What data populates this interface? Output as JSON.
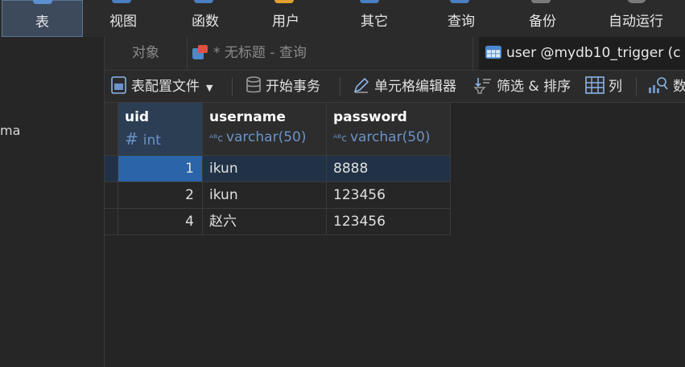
{
  "toolbar_top": {
    "items": [
      {
        "label": "表",
        "icon": "table-icon",
        "active": true
      },
      {
        "label": "视图",
        "icon": "view-icon"
      },
      {
        "label": "函数",
        "icon": "function-icon"
      },
      {
        "label": "用户",
        "icon": "user-icon"
      },
      {
        "label": "其它",
        "icon": "other-icon"
      },
      {
        "label": "查询",
        "icon": "query-icon"
      },
      {
        "label": "备份",
        "icon": "backup-icon"
      },
      {
        "label": "自动运行",
        "icon": "automation-icon"
      }
    ]
  },
  "sidebar": {
    "partial_text": "ma"
  },
  "tabs": [
    {
      "label": "对象"
    },
    {
      "label": "* 无标题 - 查询",
      "icon": "query-tab-icon"
    },
    {
      "label": "user @mydb10_trigger (c",
      "icon": "table-tab-icon",
      "active": true
    }
  ],
  "toolbar": {
    "profile_label": "表配置文件",
    "transaction_label": "开始事务",
    "cell_editor_label": "单元格编辑器",
    "filter_sort_label": "筛选 & 排序",
    "columns_label": "列",
    "data_label": "数"
  },
  "columns": [
    {
      "name": "uid",
      "type": "int"
    },
    {
      "name": "username",
      "type": "varchar(50)"
    },
    {
      "name": "password",
      "type": "varchar(50)"
    }
  ],
  "rows": [
    {
      "uid": "1",
      "username": "ikun",
      "password": "8888",
      "selected": true
    },
    {
      "uid": "2",
      "username": "ikun",
      "password": "123456"
    },
    {
      "uid": "4",
      "username": "赵六",
      "password": "123456"
    }
  ],
  "colors": {
    "accent": "#2b64a8",
    "selected_row": "#223246",
    "type_text": "#6b93c8"
  }
}
